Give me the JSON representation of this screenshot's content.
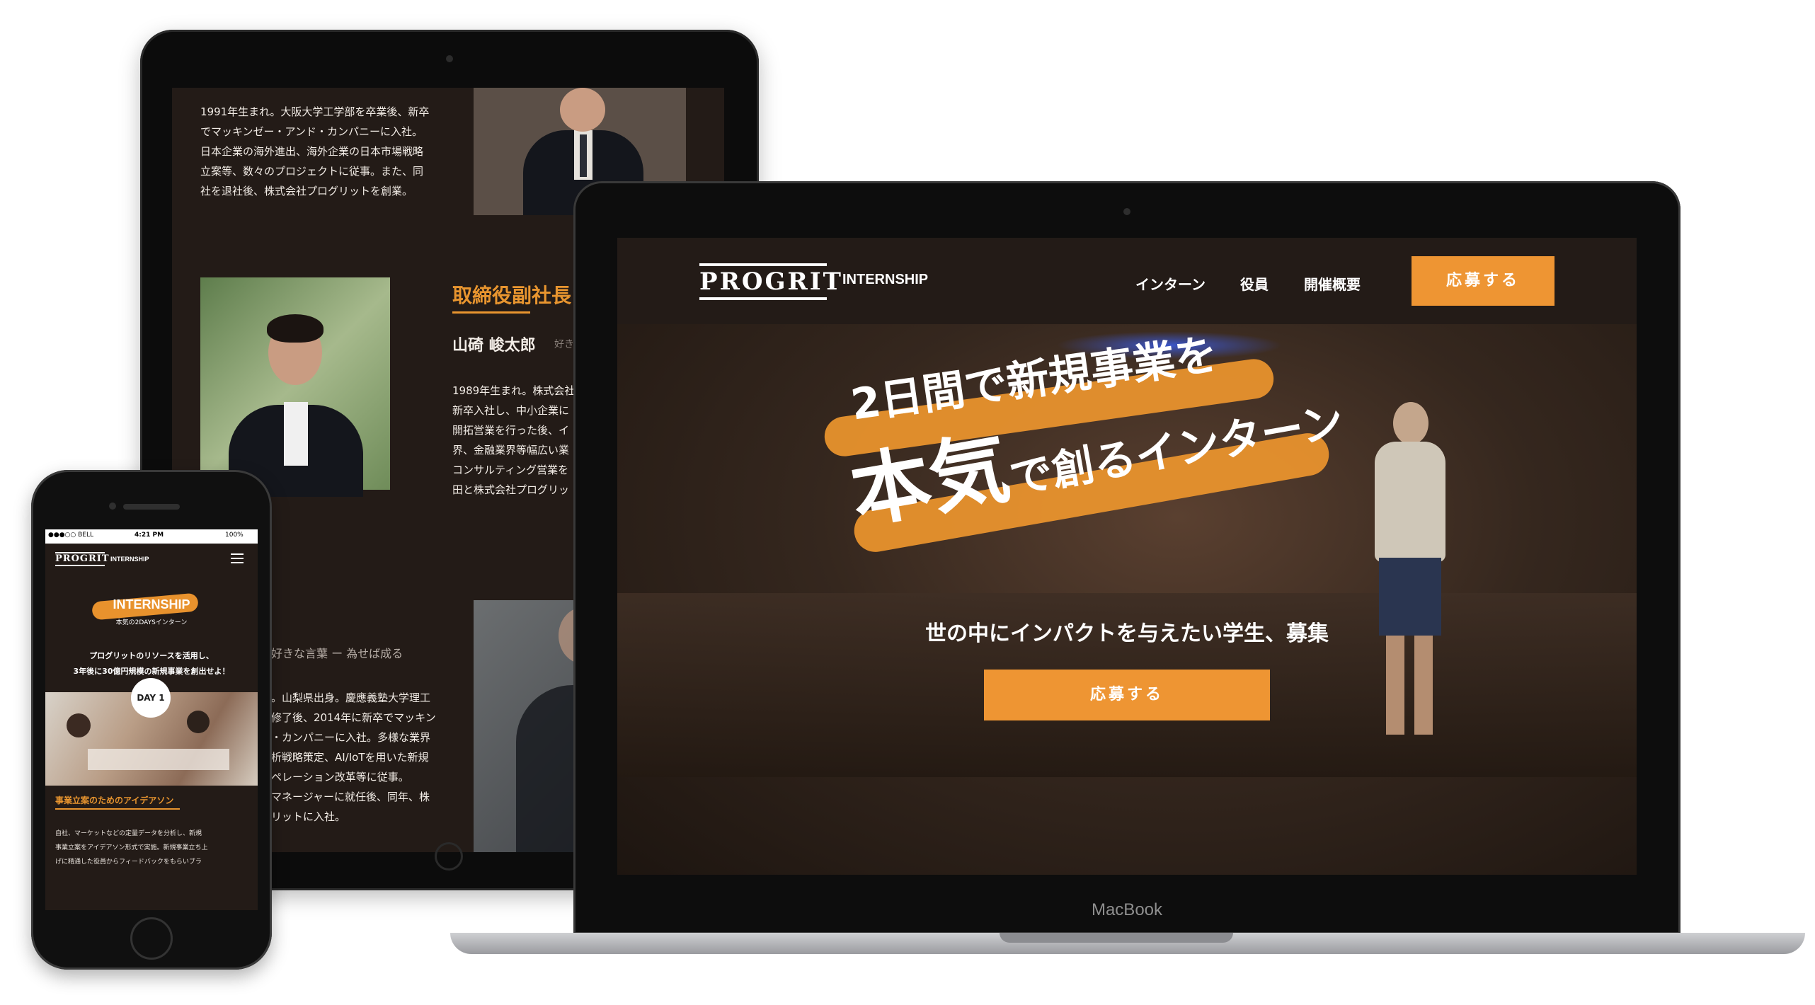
{
  "tablet": {
    "bio1": [
      "1991年生まれ。大阪大学工学部を卒業後、新卒",
      "でマッキンゼー・アンド・カンパニーに入社。",
      "日本企業の海外進出、海外企業の日本市場戦略",
      "立案等、数々のプロジェクトに従事。また、同",
      "社を退社後、株式会社プログリットを創業。"
    ],
    "role": "取締役副社長",
    "name": "山碕 峻太郎",
    "name_suffix": "好き",
    "bio2": [
      "1989年生まれ。株式会社",
      "新卒入社し、中小企業に",
      "開拓営業を行った後、イ",
      "界、金融業界等幅広い業",
      "コンサルティング営業を",
      "田と株式会社プログリッ"
    ],
    "motto": "好きな言葉 ー 為せば成る",
    "bio3": [
      "。山梨県出身。慶應義塾大学理工",
      "修了後、2014年に新卒でマッキン",
      "・カンパニーに入社。多様な業界",
      "析戦略策定、AI/IoTを用いた新規",
      "ペレーション改革等に従事。",
      "マネージャーに就任後、同年、株",
      "リットに入社。"
    ]
  },
  "laptop": {
    "logo": "PROGRIT",
    "logo_sub": "INTERNSHIP",
    "nav": [
      "インターン",
      "役員",
      "開催概要"
    ],
    "nav_cta": "応募する",
    "headline1": "2日間で新規事業を",
    "headline2_big": "本気",
    "headline2_rest": "で創るインターン",
    "subtitle": "世の中にインパクトを与えたい学生、募集",
    "cta": "応募する",
    "brand": "MacBook"
  },
  "phone": {
    "carrier": "●●●○○ BELL",
    "time": "4:21 PM",
    "battery": "100%",
    "logo": "PROGRIT",
    "logo_sub": "INTERNSHIP",
    "hero_title": "INTERNSHIP",
    "hero_sub": "本気の2DAYSインターン",
    "lead1": "プログリットのリソースを活用し、",
    "lead2": "3年後に30億円規模の新規事業を創出せよ！",
    "day_badge": "DAY 1",
    "section_title": "事業立案のためのアイデアソン",
    "body": [
      "自社、マーケットなどの定量データを分析し、新規",
      "事業立案をアイデアソン形式で実施。新規事業立ち上",
      "げに精通した役員からフィードバックをもらいブラ"
    ]
  },
  "colors": {
    "accent": "#ee9533",
    "background": "#231b17"
  }
}
